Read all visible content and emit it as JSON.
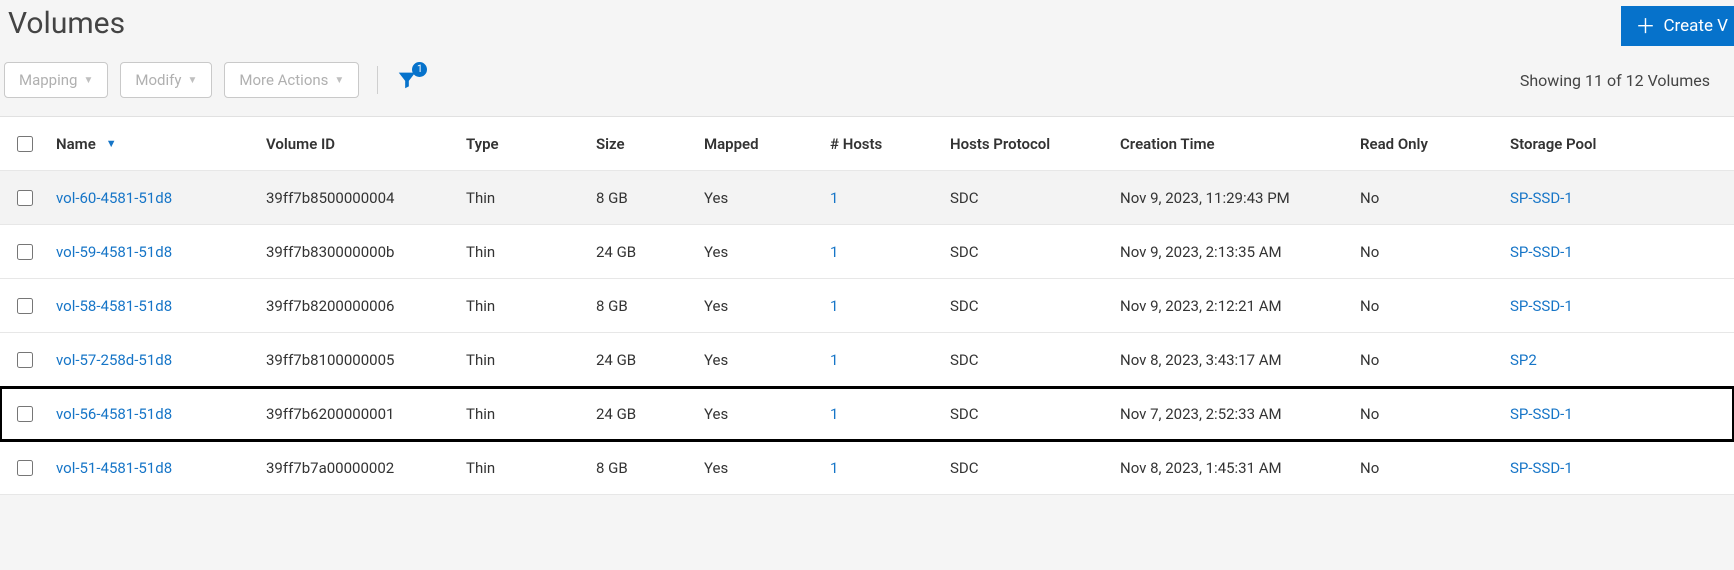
{
  "page": {
    "title": "Volumes"
  },
  "toolbar": {
    "mapping_label": "Mapping",
    "modify_label": "Modify",
    "more_actions_label": "More Actions",
    "filter_count": "1",
    "status_text": "Showing 11 of 12 Volumes",
    "create_label": "Create V"
  },
  "table": {
    "columns": {
      "name": "Name",
      "volume_id": "Volume ID",
      "type": "Type",
      "size": "Size",
      "mapped": "Mapped",
      "hosts": "# Hosts",
      "hosts_protocol": "Hosts Protocol",
      "creation_time": "Creation Time",
      "read_only": "Read Only",
      "storage_pool": "Storage Pool"
    },
    "rows": [
      {
        "name": "vol-60-4581-51d8",
        "volume_id": "39ff7b8500000004",
        "type": "Thin",
        "size": "8 GB",
        "mapped": "Yes",
        "hosts": "1",
        "hosts_protocol": "SDC",
        "creation_time": "Nov 9, 2023, 11:29:43 PM",
        "read_only": "No",
        "storage_pool": "SP-SSD-1",
        "highlight": false
      },
      {
        "name": "vol-59-4581-51d8",
        "volume_id": "39ff7b830000000b",
        "type": "Thin",
        "size": "24 GB",
        "mapped": "Yes",
        "hosts": "1",
        "hosts_protocol": "SDC",
        "creation_time": "Nov 9, 2023, 2:13:35 AM",
        "read_only": "No",
        "storage_pool": "SP-SSD-1",
        "highlight": false
      },
      {
        "name": "vol-58-4581-51d8",
        "volume_id": "39ff7b8200000006",
        "type": "Thin",
        "size": "8 GB",
        "mapped": "Yes",
        "hosts": "1",
        "hosts_protocol": "SDC",
        "creation_time": "Nov 9, 2023, 2:12:21 AM",
        "read_only": "No",
        "storage_pool": "SP-SSD-1",
        "highlight": false
      },
      {
        "name": "vol-57-258d-51d8",
        "volume_id": "39ff7b8100000005",
        "type": "Thin",
        "size": "24 GB",
        "mapped": "Yes",
        "hosts": "1",
        "hosts_protocol": "SDC",
        "creation_time": "Nov 8, 2023, 3:43:17 AM",
        "read_only": "No",
        "storage_pool": "SP2",
        "highlight": false
      },
      {
        "name": "vol-56-4581-51d8",
        "volume_id": "39ff7b6200000001",
        "type": "Thin",
        "size": "24 GB",
        "mapped": "Yes",
        "hosts": "1",
        "hosts_protocol": "SDC",
        "creation_time": "Nov 7, 2023, 2:52:33 AM",
        "read_only": "No",
        "storage_pool": "SP-SSD-1",
        "highlight": true
      },
      {
        "name": "vol-51-4581-51d8",
        "volume_id": "39ff7b7a00000002",
        "type": "Thin",
        "size": "8 GB",
        "mapped": "Yes",
        "hosts": "1",
        "hosts_protocol": "SDC",
        "creation_time": "Nov 8, 2023, 1:45:31 AM",
        "read_only": "No",
        "storage_pool": "SP-SSD-1",
        "highlight": false
      }
    ]
  }
}
